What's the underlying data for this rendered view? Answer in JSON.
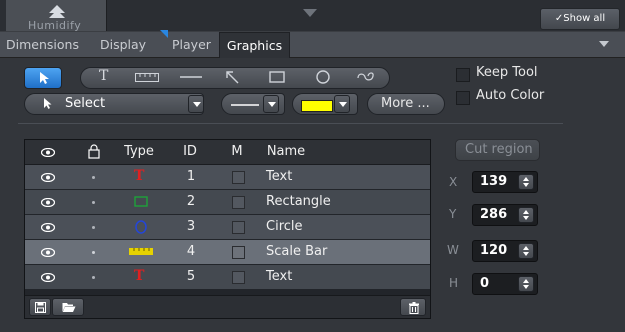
{
  "topbar": {
    "logo_label": "Humidify",
    "showall_label": "Show all"
  },
  "tabs": [
    {
      "label": "Dimensions"
    },
    {
      "label": "Display"
    },
    {
      "label": "Player"
    },
    {
      "label": "Graphics"
    }
  ],
  "toolbar": {
    "select_label": "Select",
    "more_label": "More ...",
    "keep_tool_label": "Keep Tool",
    "auto_color_label": "Auto Color",
    "line_color": "#ffff00"
  },
  "table": {
    "headers": [
      "Type",
      "ID",
      "M",
      "Name"
    ],
    "rows": [
      {
        "id": "1",
        "name": "Text",
        "type_icon": "text-type-icon"
      },
      {
        "id": "2",
        "name": "Rectangle",
        "type_icon": "rectangle-type-icon"
      },
      {
        "id": "3",
        "name": "Circle",
        "type_icon": "circle-type-icon"
      },
      {
        "id": "4",
        "name": "Scale Bar",
        "type_icon": "scale-bar-type-icon"
      },
      {
        "id": "5",
        "name": "Text",
        "type_icon": "text-type-icon"
      }
    ]
  },
  "region": {
    "cut_region_label": "Cut region",
    "x_label": "X",
    "x_value": "139",
    "y_label": "Y",
    "y_value": "286",
    "w_label": "W",
    "w_value": "120",
    "h_label": "H",
    "h_value": "0"
  },
  "colors": {
    "accent": "#2a86e0",
    "selected_tool": "#2f86e6",
    "text_type": "#e02020",
    "rect_type": "#1ea23a",
    "circle_type": "#2446d8",
    "scalebar_type": "#e6d200"
  }
}
